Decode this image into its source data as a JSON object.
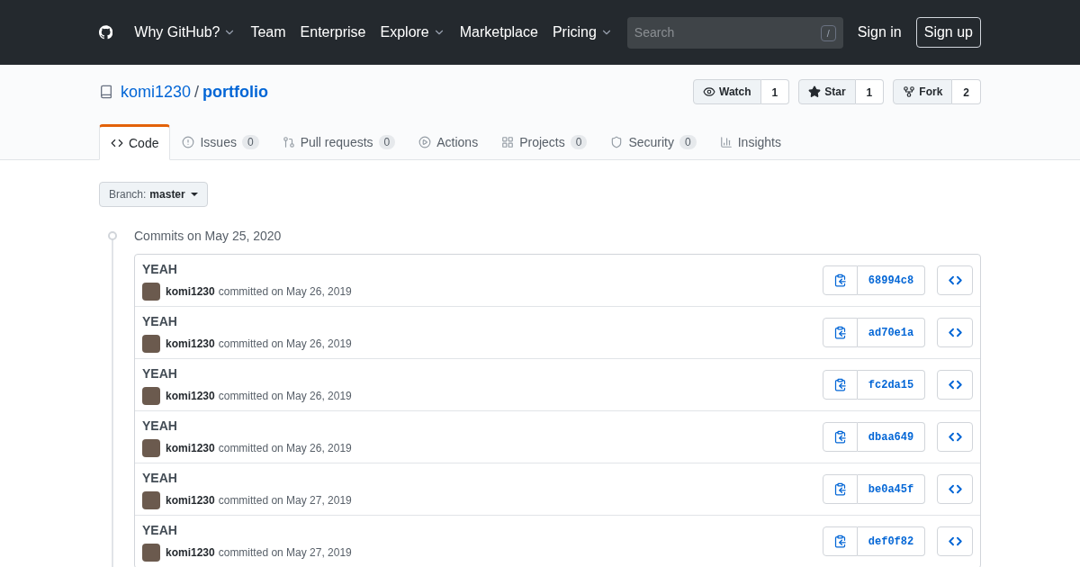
{
  "header": {
    "nav": [
      {
        "label": "Why GitHub?",
        "dropdown": true
      },
      {
        "label": "Team",
        "dropdown": false
      },
      {
        "label": "Enterprise",
        "dropdown": false
      },
      {
        "label": "Explore",
        "dropdown": true
      },
      {
        "label": "Marketplace",
        "dropdown": false
      },
      {
        "label": "Pricing",
        "dropdown": true
      }
    ],
    "search": {
      "placeholder": "Search",
      "key": "/"
    },
    "sign_in": "Sign in",
    "sign_up": "Sign up"
  },
  "repo": {
    "owner": "komi1230",
    "separator": "/",
    "name": "portfolio",
    "actions": [
      {
        "kind": "watch",
        "label": "Watch",
        "count": "1"
      },
      {
        "kind": "star",
        "label": "Star",
        "count": "1"
      },
      {
        "kind": "fork",
        "label": "Fork",
        "count": "2"
      }
    ],
    "tabs": [
      {
        "kind": "code",
        "label": "Code",
        "selected": true
      },
      {
        "kind": "issues",
        "label": "Issues",
        "counter": "0",
        "selected": false
      },
      {
        "kind": "pulls",
        "label": "Pull requests",
        "counter": "0",
        "selected": false
      },
      {
        "kind": "actions",
        "label": "Actions",
        "selected": false
      },
      {
        "kind": "projects",
        "label": "Projects",
        "counter": "0",
        "selected": false
      },
      {
        "kind": "security",
        "label": "Security",
        "counter": "0",
        "selected": false
      },
      {
        "kind": "insights",
        "label": "Insights",
        "selected": false
      }
    ]
  },
  "branch": {
    "prefix": "Branch:",
    "name": "master"
  },
  "commit_group": {
    "heading": "Commits on May 25, 2020",
    "commits": [
      {
        "message": "YEAH",
        "author": "komi1230",
        "meta": "committed on May 26, 2019",
        "sha": "68994c8"
      },
      {
        "message": "YEAH",
        "author": "komi1230",
        "meta": "committed on May 26, 2019",
        "sha": "ad70e1a"
      },
      {
        "message": "YEAH",
        "author": "komi1230",
        "meta": "committed on May 26, 2019",
        "sha": "fc2da15"
      },
      {
        "message": "YEAH",
        "author": "komi1230",
        "meta": "committed on May 26, 2019",
        "sha": "dbaa649"
      },
      {
        "message": "YEAH",
        "author": "komi1230",
        "meta": "committed on May 27, 2019",
        "sha": "be0a45f"
      },
      {
        "message": "YEAH",
        "author": "komi1230",
        "meta": "committed on May 27, 2019",
        "sha": "def0f82"
      }
    ]
  }
}
